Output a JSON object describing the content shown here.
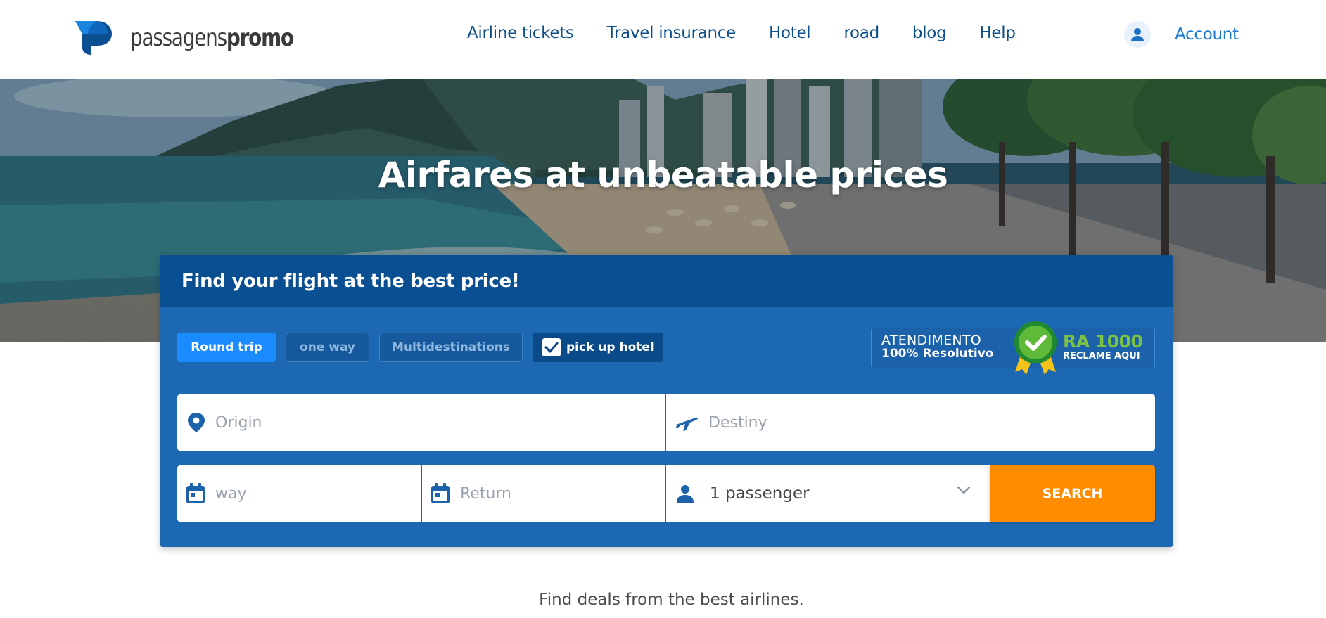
{
  "brand": {
    "name_light": "passagens",
    "name_bold": "promo"
  },
  "nav": {
    "items": [
      {
        "label": "Airline tickets"
      },
      {
        "label": "Travel insurance"
      },
      {
        "label": "Hotel"
      },
      {
        "label": "road"
      },
      {
        "label": "blog"
      },
      {
        "label": "Help"
      }
    ],
    "account_label": "Account"
  },
  "hero": {
    "title": "Airfares at unbeatable prices"
  },
  "search": {
    "title": "Find your flight at the best price!",
    "trip_types": {
      "round_trip": "Round trip",
      "one_way": "one way",
      "multi": "Multidestinations",
      "pickup_hotel": "pick up hotel"
    },
    "pickup_hotel_checked": true,
    "origin_placeholder": "Origin",
    "destination_placeholder": "Destiny",
    "departure_placeholder": "way",
    "return_placeholder": "Return",
    "passengers_value": "1 passenger",
    "search_button": "SEARCH"
  },
  "badge": {
    "line1": "ATENDIMENTO",
    "line2": "100% Resolutivo",
    "ra_title": "RA 1000",
    "ra_sub": "RECLAME AQUI"
  },
  "deals_text": "Find deals from the best airlines.",
  "colors": {
    "nav_text": "#0d4f8b",
    "card_bg": "#1d68b3",
    "card_header": "#0a4f92",
    "active_tab": "#1a8cff",
    "search_button": "#ff8b00",
    "ra_green": "#7dc142"
  },
  "icons": [
    "logo-mark-icon",
    "user-icon",
    "map-pin-icon",
    "airplane-icon",
    "calendar-icon",
    "person-icon",
    "chevron-down-icon",
    "check-icon",
    "seal-check-icon"
  ]
}
